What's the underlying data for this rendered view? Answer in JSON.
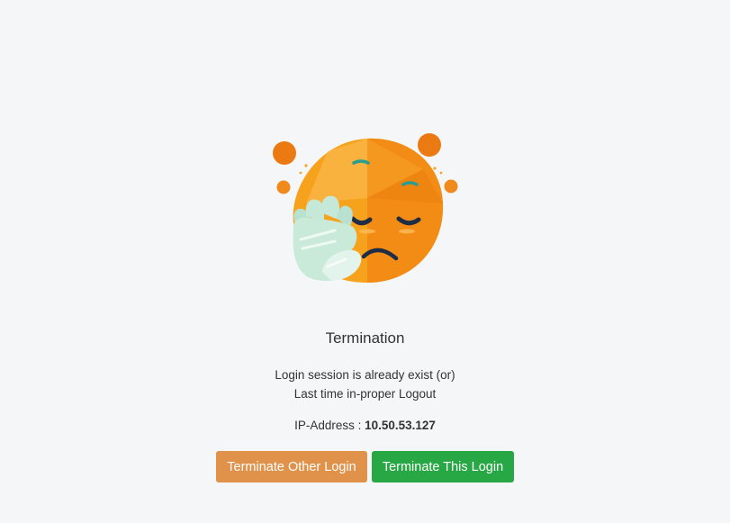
{
  "termination": {
    "title": "Termination",
    "message_line1": "Login session is already exist (or)",
    "message_line2": "Last time in-proper Logout",
    "ip_label": "IP-Address :",
    "ip_value": "10.50.53.127"
  },
  "actions": {
    "terminate_other_label": "Terminate Other Login",
    "terminate_this_label": "Terminate This Login"
  },
  "colors": {
    "terminate_other": "#e0924a",
    "terminate_this": "#27a844",
    "emoji_orange": "#f7a21c",
    "background": "#f5f6f8"
  },
  "icons": {
    "illustration": "facepalm-emoji-icon"
  }
}
